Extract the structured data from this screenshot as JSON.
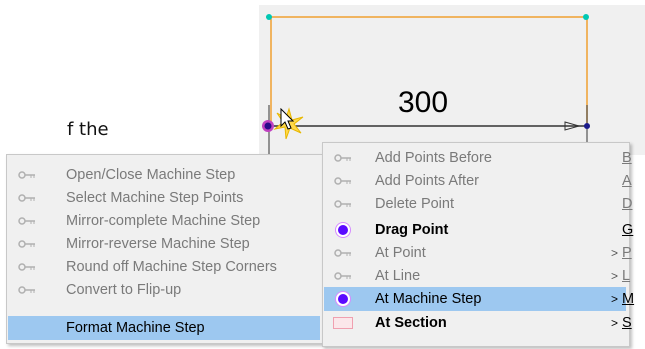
{
  "background_text": "f the",
  "dimension_value": "300",
  "colors": {
    "highlight": "#9dc8f0",
    "shape_outline": "#f0a030",
    "handle": "#00c8b4",
    "selected_point": "#5a0aff"
  },
  "left_menu": {
    "items": [
      {
        "label": "Open/Close Machine Step",
        "icon": "key-icon"
      },
      {
        "label": "Select Machine Step Points",
        "icon": "key-icon"
      },
      {
        "label": "Mirror-complete Machine Step",
        "icon": "key-icon"
      },
      {
        "label": "Mirror-reverse Machine Step",
        "icon": "key-icon"
      },
      {
        "label": "Round off Machine Step Corners",
        "icon": "key-icon"
      },
      {
        "label": "Convert to Flip-up",
        "icon": "key-icon"
      },
      {
        "label": "Format Machine Step",
        "icon": ""
      }
    ]
  },
  "right_menu": {
    "items": [
      {
        "label": "Add Points Before",
        "shortcut": "B",
        "icon": "key-icon"
      },
      {
        "label": "Add Points After",
        "shortcut": "A",
        "icon": "key-icon"
      },
      {
        "label": "Delete Point",
        "shortcut": "D",
        "icon": "key-icon"
      },
      {
        "label": "Drag Point",
        "shortcut": "G",
        "icon": "radio-icon"
      },
      {
        "label": "At Point",
        "shortcut": "P",
        "icon": "key-icon",
        "submenu": ">"
      },
      {
        "label": "At Line",
        "shortcut": "L",
        "icon": "key-icon",
        "submenu": ">"
      },
      {
        "label": "At Machine Step",
        "shortcut": "M",
        "icon": "radio-icon",
        "submenu": ">"
      },
      {
        "label": "At Section",
        "shortcut": "S",
        "icon": "rectangle-icon",
        "submenu": ">"
      }
    ]
  }
}
